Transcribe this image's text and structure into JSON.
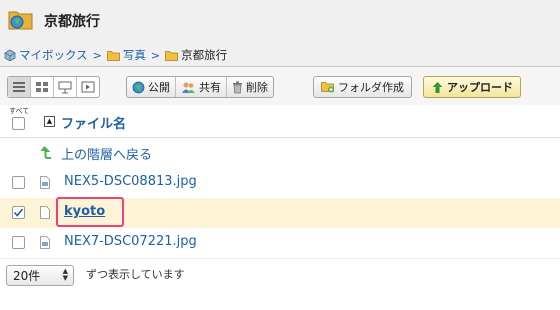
{
  "header": {
    "title": "京都旅行"
  },
  "breadcrumb": {
    "items": [
      "マイボックス",
      "写真"
    ],
    "current": "京都旅行",
    "separator": ">"
  },
  "toolbar": {
    "public_label": "公開",
    "share_label": "共有",
    "delete_label": "削除",
    "new_folder_label": "フォルダ作成",
    "upload_label": "アップロード"
  },
  "list": {
    "select_all_label": "すべて",
    "column_name": "ファイル名",
    "sort_indicator": "▲",
    "parent_label": "上の階層へ戻る",
    "items": [
      {
        "name": "NEX5-DSC08813.jpg",
        "checked": false
      },
      {
        "name": "kyoto",
        "checked": true
      },
      {
        "name": "NEX7-DSC07221.jpg",
        "checked": false
      }
    ]
  },
  "footer": {
    "per_page_value": "20件",
    "per_page_text": "ずつ表示しています"
  },
  "colors": {
    "link": "#1f5fa6",
    "selected_row": "#fdf3d7",
    "highlight": "#e8437a"
  }
}
